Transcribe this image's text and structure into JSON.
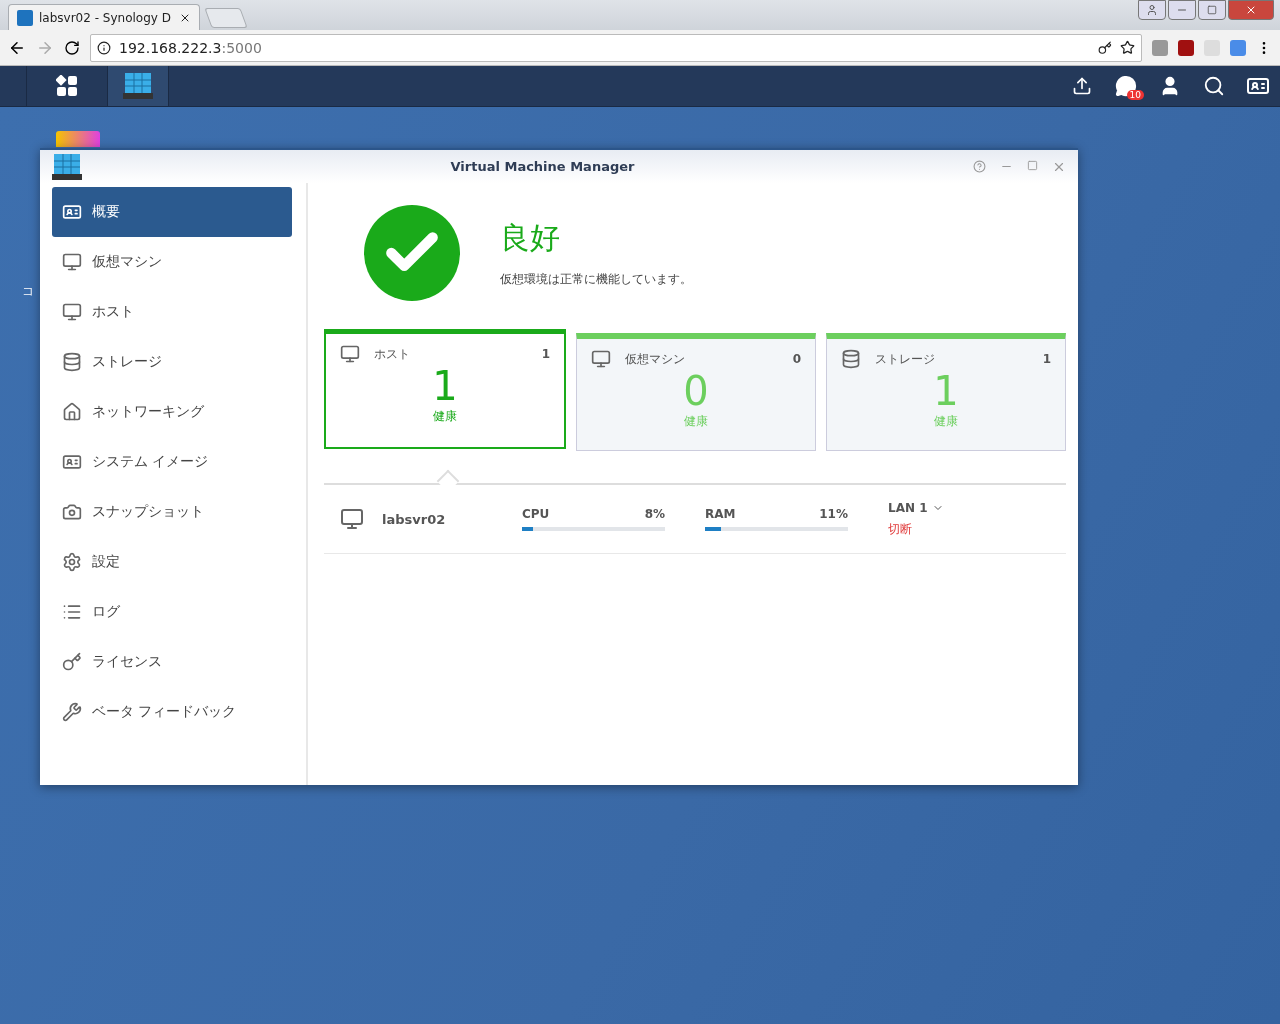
{
  "browser": {
    "tab_title": "labsvr02 - Synology D",
    "url_host": "192.168.222.3",
    "url_port": ":5000"
  },
  "taskbar": {
    "notification_count": "10"
  },
  "desktop": {
    "icon_label": "コ"
  },
  "window": {
    "title": "Virtual Machine Manager"
  },
  "sidebar": {
    "items": [
      {
        "label": "概要",
        "selected": true
      },
      {
        "label": "仮想マシン",
        "selected": false
      },
      {
        "label": "ホスト",
        "selected": false
      },
      {
        "label": "ストレージ",
        "selected": false
      },
      {
        "label": "ネットワーキング",
        "selected": false
      },
      {
        "label": "システム イメージ",
        "selected": false
      },
      {
        "label": "スナップショット",
        "selected": false
      },
      {
        "label": "設定",
        "selected": false
      },
      {
        "label": "ログ",
        "selected": false
      },
      {
        "label": "ライセンス",
        "selected": false
      },
      {
        "label": "ベータ フィードバック",
        "selected": false
      }
    ]
  },
  "status": {
    "title": "良好",
    "message": "仮想環境は正常に機能しています。"
  },
  "cards": [
    {
      "label": "ホスト",
      "count": "1",
      "value": "1",
      "status": "健康",
      "selected": true
    },
    {
      "label": "仮想マシン",
      "count": "0",
      "value": "0",
      "status": "健康",
      "selected": false
    },
    {
      "label": "ストレージ",
      "count": "1",
      "value": "1",
      "status": "健康",
      "selected": false
    }
  ],
  "host_row": {
    "name": "labsvr02",
    "meters": [
      {
        "label": "CPU",
        "reading": "8%",
        "level": 0.08
      },
      {
        "label": "RAM",
        "reading": "11%",
        "level": 0.11
      }
    ],
    "network": {
      "label": "LAN 1",
      "status": "切断"
    }
  }
}
